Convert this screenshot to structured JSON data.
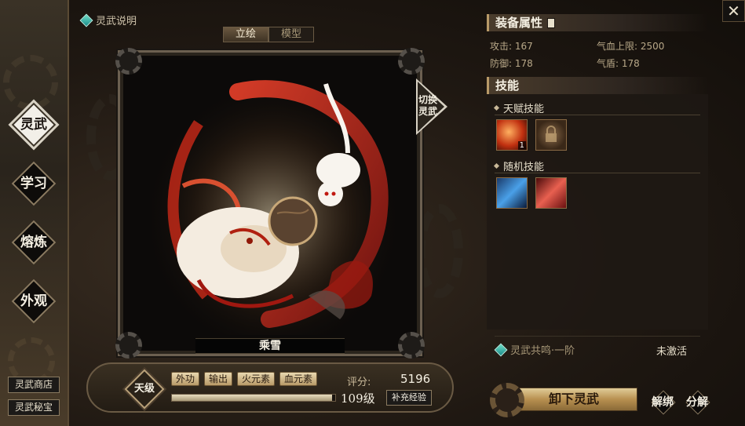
{
  "left_nav": {
    "items": [
      {
        "label": "灵武",
        "active": true
      },
      {
        "label": "学习",
        "active": false
      },
      {
        "label": "熔炼",
        "active": false
      },
      {
        "label": "外观",
        "active": false
      }
    ],
    "shop_label": "灵武商店",
    "treasure_label": "灵武秘宝"
  },
  "header": {
    "help_label": "灵武说明",
    "tabs": [
      {
        "label": "立绘",
        "active": true
      },
      {
        "label": "模型",
        "active": false
      }
    ]
  },
  "portrait": {
    "name": "乘雪",
    "switch_label": "切换灵武"
  },
  "info_bar": {
    "rank": "天级",
    "tags": [
      "外功",
      "输出",
      "火元素",
      "血元素"
    ],
    "score_label": "评分:",
    "score_value": "5196",
    "level": "109级",
    "exp_fraction": 0.98,
    "exp_button": "补充经验"
  },
  "attributes": {
    "title": "装备属性",
    "items": [
      {
        "text": "攻击: 167"
      },
      {
        "text": "气血上限: 2500"
      },
      {
        "text": "防御: 178"
      },
      {
        "text": "气盾: 178"
      }
    ]
  },
  "skills": {
    "title": "技能",
    "talent_label": "天赋技能",
    "talent_skill_count": "1",
    "random_label": "随机技能"
  },
  "resonance": {
    "label": "灵武共鸣·一阶",
    "status": "未激活"
  },
  "buttons": {
    "unequip": "卸下灵武",
    "unbind": "解绑",
    "decompose": "分解",
    "close": "✕"
  },
  "colors": {
    "accent_gold": "#b89a68",
    "text_light": "#f4efe2",
    "help_icon": "#4fc8b8"
  }
}
